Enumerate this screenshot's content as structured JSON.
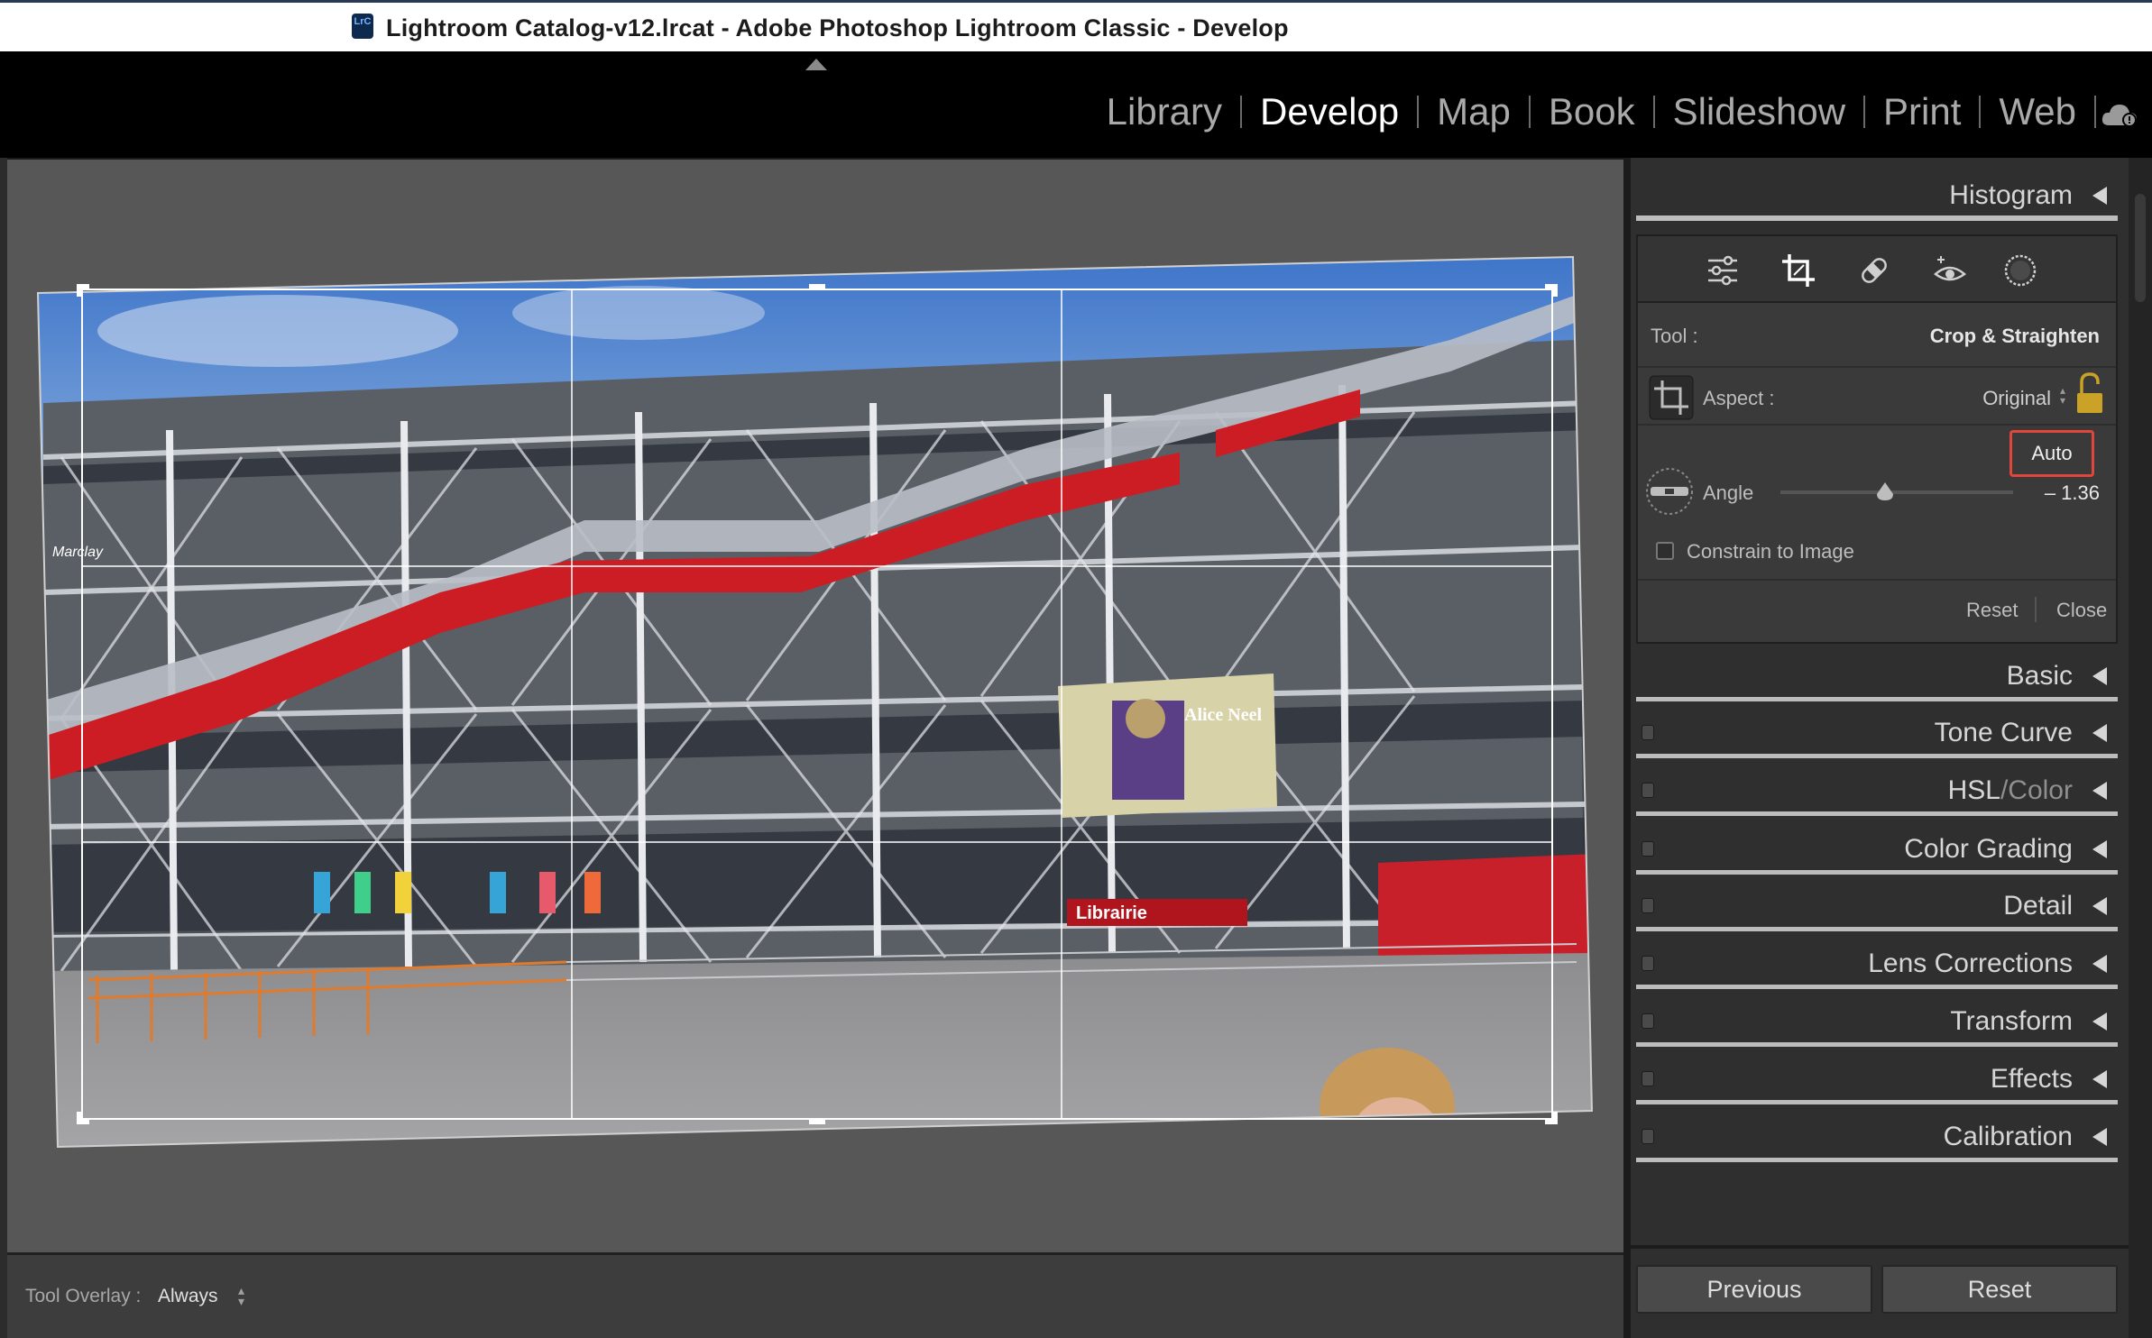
{
  "window": {
    "title": "Lightroom Catalog-v12.lrcat - Adobe Photoshop Lightroom Classic - Develop",
    "app_icon_text": "LrC"
  },
  "modules": [
    {
      "label": "Library",
      "active": false
    },
    {
      "label": "Develop",
      "active": true
    },
    {
      "label": "Map",
      "active": false
    },
    {
      "label": "Book",
      "active": false
    },
    {
      "label": "Slideshow",
      "active": false
    },
    {
      "label": "Print",
      "active": false
    },
    {
      "label": "Web",
      "active": false
    }
  ],
  "histogram": {
    "title": "Histogram"
  },
  "tools": [
    "edit-sliders-icon",
    "crop-icon",
    "healing-icon",
    "red-eye-icon",
    "masking-icon"
  ],
  "crop": {
    "tool_label": "Tool :",
    "tool_value": "Crop & Straighten",
    "aspect_label": "Aspect :",
    "aspect_value": "Original",
    "auto_label": "Auto",
    "angle_label": "Angle",
    "angle_value": "– 1.36",
    "angle_fraction": 0.45,
    "constrain_label": "Constrain to Image",
    "reset_label": "Reset",
    "close_label": "Close"
  },
  "panels": {
    "basic": "Basic",
    "tone_curve": "Tone Curve",
    "hsl": "HSL",
    "hsl_sep": "/",
    "color": "Color",
    "color_grading": "Color Grading",
    "detail": "Detail",
    "lens_corrections": "Lens Corrections",
    "transform": "Transform",
    "effects": "Effects",
    "calibration": "Calibration"
  },
  "toolbar": {
    "overlay_label": "Tool Overlay :",
    "overlay_value": "Always"
  },
  "buttons": {
    "previous": "Previous",
    "reset": "Reset"
  },
  "photo": {
    "banner_text": "Alice Neel",
    "shop_sign": "Librairie",
    "side_text": "Marclay"
  },
  "colors": {
    "accent_red": "#e0463a",
    "lock_gold": "#c9a227"
  }
}
